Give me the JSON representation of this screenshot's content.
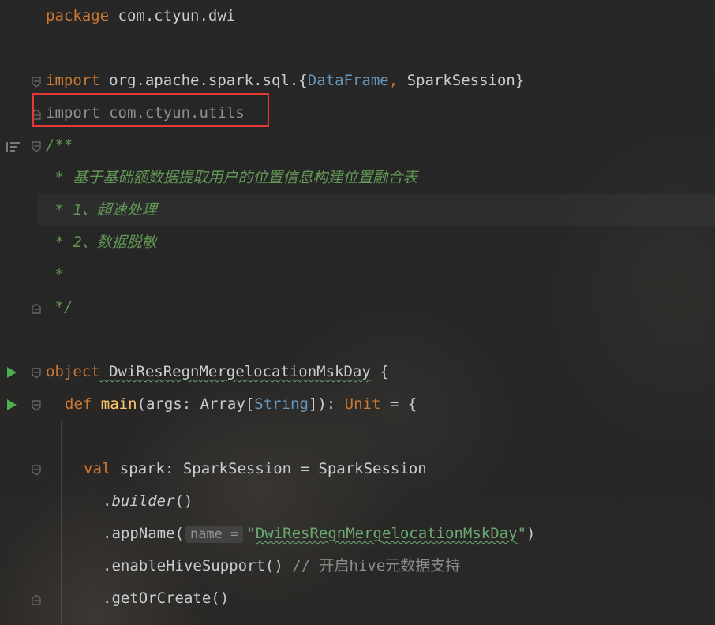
{
  "code": {
    "l1_kw": "package",
    "l1_rest": " com.ctyun.dwi",
    "l3_kw": "import",
    "l3_pkg": " org.apache.spark.sql.{",
    "l3_t1": "DataFrame",
    "l3_sep": ", ",
    "l3_t2": "SparkSession",
    "l3_end": "}",
    "l4_text": "import com.ctyun.utils",
    "l5_text": "/**",
    "l6_text": " * 基于基础额数据提取用户的位置信息构建位置融合表",
    "l7_text": " * 1、超速处理",
    "l8_text": " * 2、数据脱敏",
    "l9_text": " *",
    "l10_text": " */",
    "l12_kw": "object",
    "l12_name": " DwiResRegnMergelocationMskDay",
    "l12_end": " {",
    "l13_kw": "def",
    "l13_fn": "main",
    "l13_p1": "(args: Array[",
    "l13_t": "String",
    "l13_p2": "]): ",
    "l13_unit": "Unit",
    "l13_end": " = {",
    "l15_kw": "val",
    "l15_rest": " spark: SparkSession = SparkSession",
    "l16_dot": ".",
    "l16_m": "builder",
    "l16_end": "()",
    "l17_a": ".appName(",
    "l17_hint": "name =",
    "l17_str_q1": "\"",
    "l17_str": "DwiResRegnMergelocationMskDay",
    "l17_str_q2": "\"",
    "l17_end": ")",
    "l18_a": ".enableHiveSupport()",
    "l18_cmt": " // 开启hive元数据支持",
    "l19_a": ".getOrCreate()"
  },
  "colors": {
    "keyword": "#cc7832",
    "type": "#6897bb",
    "string": "#6aab73",
    "function": "#ffc66d",
    "doc_comment": "#629755",
    "highlight_box": "#e53935",
    "run_icon": "#4caf50"
  },
  "icons": {
    "fold": "fold-marker-icon",
    "run": "run-gutter-icon",
    "doc": "render-doc-icon"
  }
}
